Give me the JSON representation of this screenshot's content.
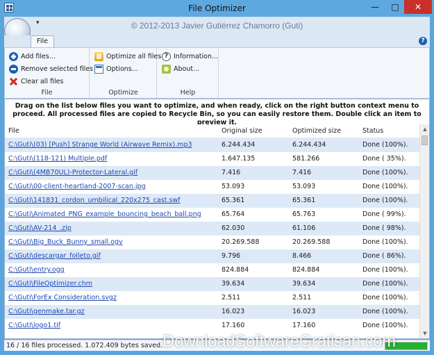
{
  "window": {
    "title": "File Optimizer"
  },
  "header": {
    "copyright": "© 2012-2013 Javier Gutiérrez Chamorro (Guti)"
  },
  "ribbon": {
    "tab_file": "File",
    "groups": {
      "file": {
        "label": "File",
        "add": "Add files...",
        "remove": "Remove selected files",
        "clear": "Clear all files"
      },
      "optimize": {
        "label": "Optimize",
        "optimize_all": "Optimize all files",
        "options": "Options..."
      },
      "help": {
        "label": "Help",
        "information": "Information...",
        "about": "About..."
      }
    }
  },
  "instructions": "Drag on the list below files you want to optimize, and when ready, click on the right button context menu to proceed. All processed files are copied to Recycle Bin, so you can easily restore them. Double click an item to preview it.",
  "table": {
    "headers": {
      "file": "File",
      "original": "Original size",
      "optimized": "Optimized size",
      "status": "Status"
    },
    "rows": [
      {
        "file": "C:\\Guti\\(03) [Push] Strange World (Airwave Remix).mp3",
        "original": "6.244.434",
        "optimized": "6.244.434",
        "status": "Done (100%)."
      },
      {
        "file": "C:\\Guti\\(118-121) Multiple.pdf",
        "original": "1.647.135",
        "optimized": "581.266",
        "status": "Done ( 35%)."
      },
      {
        "file": "C:\\Guti\\(4MB70UL)-Protector-Lateral.gif",
        "original": "7.416",
        "optimized": "7.416",
        "status": "Done (100%)."
      },
      {
        "file": "C:\\Guti\\00-client-heartland-2007-scan.jpg",
        "original": "53.093",
        "optimized": "53.093",
        "status": "Done (100%)."
      },
      {
        "file": "C:\\Guti\\141831_cordon_umbilical_220x275_cast.swf",
        "original": "65.361",
        "optimized": "65.361",
        "status": "Done (100%)."
      },
      {
        "file": "C:\\Guti\\Animated_PNG_example_bouncing_beach_ball.png",
        "original": "65.764",
        "optimized": "65.763",
        "status": "Done ( 99%)."
      },
      {
        "file": "C:\\Guti\\AV-214_.zip",
        "original": "62.030",
        "optimized": "61.106",
        "status": "Done ( 98%)."
      },
      {
        "file": "C:\\Guti\\Big_Buck_Bunny_small.ogv",
        "original": "20.269.588",
        "optimized": "20.269.588",
        "status": "Done (100%)."
      },
      {
        "file": "C:\\Guti\\descargar_folleto.gif",
        "original": "9.796",
        "optimized": "8.466",
        "status": "Done ( 86%)."
      },
      {
        "file": "C:\\Guti\\entry.ogg",
        "original": "824.884",
        "optimized": "824.884",
        "status": "Done (100%)."
      },
      {
        "file": "C:\\Guti\\FileOptimizer.chm",
        "original": "39.634",
        "optimized": "39.634",
        "status": "Done (100%)."
      },
      {
        "file": "C:\\Guti\\ForEx Consideration.svgz",
        "original": "2.511",
        "optimized": "2.511",
        "status": "Done (100%)."
      },
      {
        "file": "C:\\Guti\\genmake.tar.gz",
        "original": "16.023",
        "optimized": "16.023",
        "status": "Done (100%)."
      },
      {
        "file": "C:\\Guti\\logo1.tif",
        "original": "17.160",
        "optimized": "17.160",
        "status": "Done (100%)."
      }
    ]
  },
  "status_bar": {
    "text": "16 / 16 files processed. 1.072.409 bytes saved.",
    "progress": 1.0,
    "progress_color": "#26b030"
  },
  "watermark": "DownloadSoftwareGratisan.com"
}
